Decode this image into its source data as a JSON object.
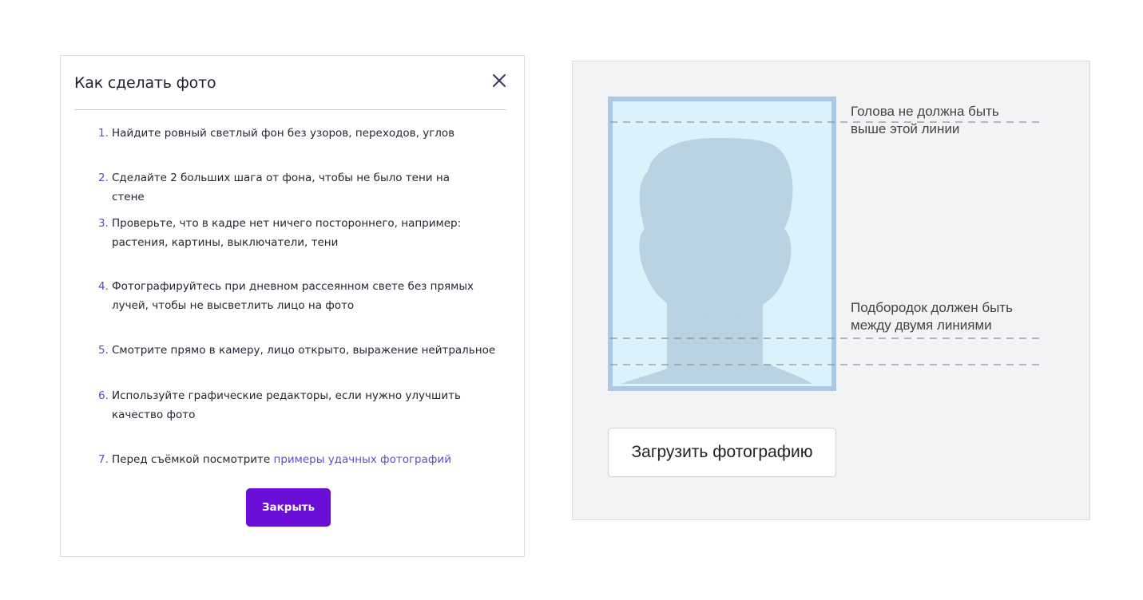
{
  "modal": {
    "title": "Как сделать фото",
    "close_icon": "close-icon",
    "steps": [
      {
        "num": "1.",
        "text": "Найдите ровный светлый фон без узоров, переходов, углов"
      },
      {
        "num": "2.",
        "text": "Сделайте 2 больших шага от фона, чтобы не было тени на стене"
      },
      {
        "num": "3.",
        "text": "Проверьте, что в кадре нет ничего постороннего, например: растения, картины, выключатели, тени"
      },
      {
        "num": "4.",
        "text": "Фотографируйтесь при дневном рассеянном свете без прямых лучей, чтобы не высветлить лицо на фото"
      },
      {
        "num": "5.",
        "text": "Смотрите прямо в камеру, лицо открыто, выражение нейтральное"
      },
      {
        "num": "6.",
        "text": "Используйте графические редакторы, если нужно улучшить качество фото"
      },
      {
        "num": "7.",
        "text": "Перед съёмкой посмотрите ",
        "link": "примеры удачных фотографий"
      }
    ],
    "close_button": "Закрыть",
    "accent_color": "#6b0fd8",
    "link_color": "#5b4fd0"
  },
  "guide": {
    "head_note_line1": "Голова не должна быть",
    "head_note_line2": "выше этой линии",
    "chin_note_line1": "Подбородок должен быть",
    "chin_note_line2": "между двумя линиями",
    "upload_button": "Загрузить фотографию",
    "silhouette_icon": "person-silhouette-icon",
    "frame_color": "#aac8e8",
    "photo_bg_color": "#dcf2fb",
    "silhouette_color": "#b9d3e3"
  }
}
